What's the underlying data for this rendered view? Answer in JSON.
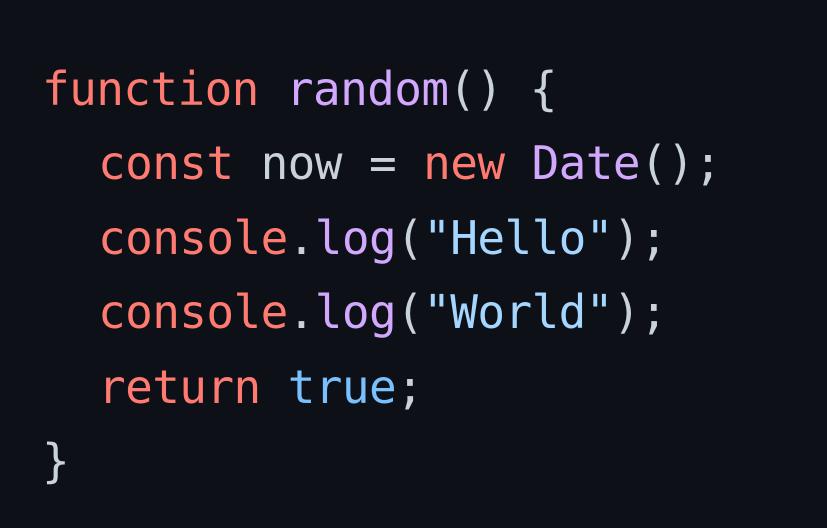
{
  "colors": {
    "background": "#0d1117",
    "keyword": "#ff7b72",
    "function": "#d2a8ff",
    "string": "#a5d6ff",
    "constant": "#79c0ff",
    "plain": "#c9d1d9"
  },
  "code": {
    "line1": {
      "kw_function": "function",
      "sp1": " ",
      "fn_name": "random",
      "params": "() {"
    },
    "line2": {
      "kw_const": "const",
      "var_decl": " now = ",
      "kw_new": "new",
      "sp": " ",
      "cls_date": "Date",
      "call_end": "();"
    },
    "line3": {
      "obj": "console",
      "dot": ".",
      "method": "log",
      "open": "(",
      "str": "\"Hello\"",
      "close": ");"
    },
    "line4": {
      "obj": "console",
      "dot": ".",
      "method": "log",
      "open": "(",
      "str": "\"World\"",
      "close": ");"
    },
    "line5": {
      "kw_return": "return",
      "sp": " ",
      "val_true": "true",
      "semi": ";"
    },
    "line6": {
      "brace": "}"
    }
  }
}
